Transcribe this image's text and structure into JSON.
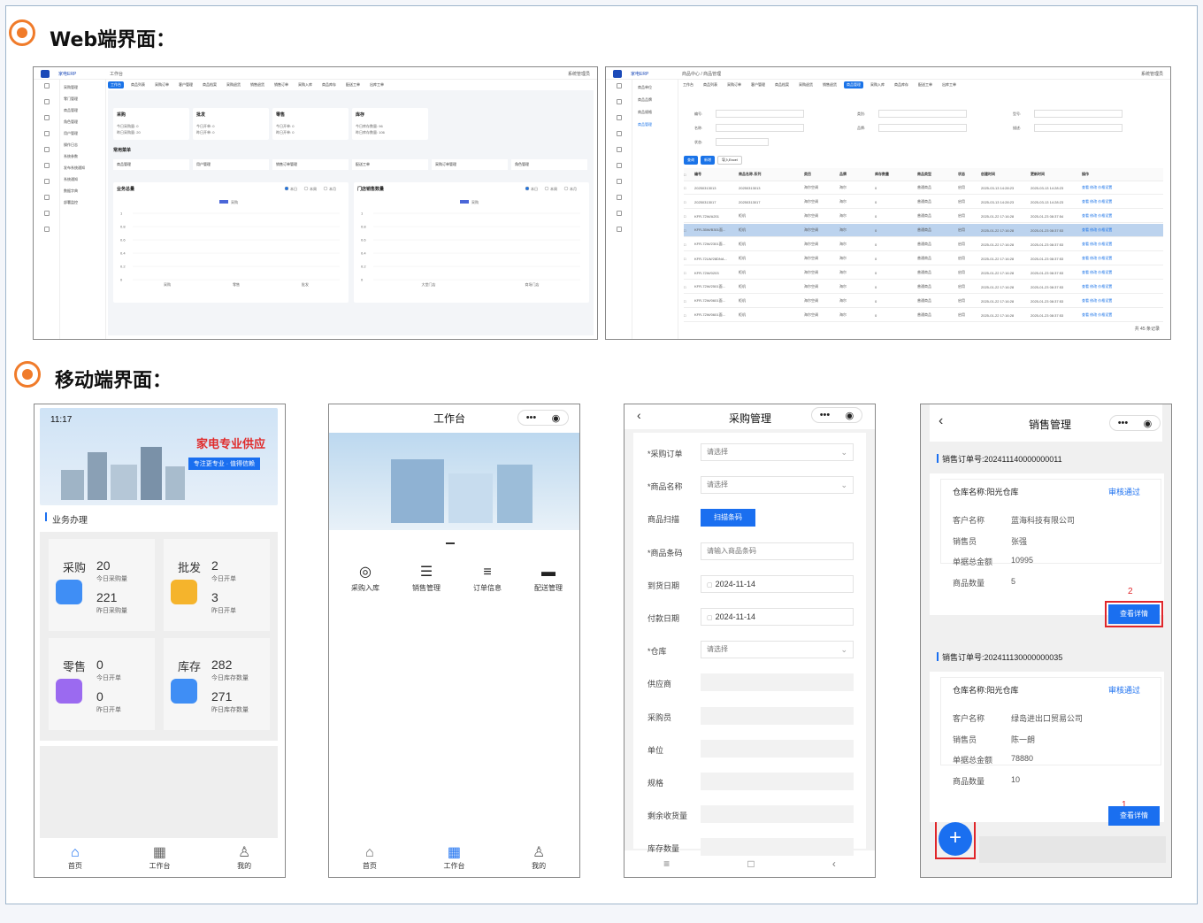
{
  "sections": {
    "web_title": "Web端界面：",
    "mobile_title": "移动端界面："
  },
  "web1": {
    "brand": "家电ERP",
    "breadcrumb": "工作台",
    "user": "系统管理员",
    "tabs": [
      "工作台",
      "商品列表",
      "采购订单",
      "客户管理",
      "商品档案",
      "采购退货",
      "销售退货",
      "销售订单",
      "采购入库",
      "商品库存",
      "配送工单",
      "出库工单"
    ],
    "menu": [
      "采购管理",
      "零门管理",
      "商品管理",
      "角色管理",
      "用户管理",
      "操作日志",
      "系统参数",
      "发布系统通知",
      "系统通知",
      "数据字典",
      "部署监控"
    ],
    "cards": [
      {
        "title": "采购",
        "l1": "今日采购量: 0",
        "l2": "昨日采购量: 20"
      },
      {
        "title": "批发",
        "l1": "今日开单: 0",
        "l2": "昨日开单: 0"
      },
      {
        "title": "零售",
        "l1": "今日开单: 0",
        "l2": "昨日开单: 0"
      },
      {
        "title": "库存",
        "l1": "今日库存数量: 96",
        "l2": "昨日库存数量: 106"
      }
    ],
    "common_title": "常用菜单",
    "common": [
      "商品管理",
      "用户管理",
      "销售订单管理",
      "配送工单",
      "采购订单管理",
      "角色管理"
    ],
    "chart1": {
      "title": "业务总量",
      "legend": "采购",
      "filters": [
        "本日",
        "本周",
        "本月"
      ],
      "ticks": [
        "1",
        "0.8",
        "0.6",
        "0.4",
        "0.2",
        "0"
      ],
      "x": [
        "采购",
        "零售",
        "批发"
      ]
    },
    "chart2": {
      "title": "门店销售数量",
      "legend": "采购",
      "filters": [
        "本日",
        "本周",
        "本月"
      ],
      "ticks": [
        "1",
        "0.8",
        "0.6",
        "0.4",
        "0.2",
        "0"
      ],
      "x": [
        "大堂门店",
        "商场门店"
      ]
    }
  },
  "web2": {
    "brand": "家电ERP",
    "breadcrumb": "商品中心 / 商品管理",
    "user": "系统管理员",
    "tabs": [
      "工作台",
      "商品列表",
      "采购订单",
      "客户管理",
      "商品档案",
      "采购退货",
      "销售退货",
      "商品管理",
      "采购入库",
      "商品库存",
      "配送工单",
      "出库工单"
    ],
    "menu": [
      "商品单位",
      "商品品牌",
      "商品规格",
      "商品管理"
    ],
    "filters": [
      "编号:",
      "类别:",
      "型号:",
      "名称:",
      "品牌:",
      "描述:",
      "状态:"
    ],
    "buttons": [
      "查询",
      "新增",
      "导入Excel"
    ],
    "headers": [
      "编号",
      "商品名称-系列",
      "类目",
      "品牌",
      "库存数量",
      "商品类型",
      "状态",
      "创建时间",
      "更新时间",
      "操作"
    ],
    "rows": [
      [
        "20250313013",
        "20250313013",
        "海尔空调",
        "海尔",
        "0",
        "普通商品",
        "启用",
        "2025-03-13 14:28:23",
        "2025-03-13 14:28:23",
        "查看 修改 价格设置"
      ],
      [
        "20250313017",
        "20250313017",
        "海尔空调",
        "海尔",
        "0",
        "普通商品",
        "启用",
        "2025-03-13 14:28:23",
        "2025-03-13 14:28:23",
        "查看 修改 价格设置"
      ],
      [
        "KFR-72W/A201",
        "柜机",
        "海尔空调",
        "海尔",
        "0",
        "普通商品",
        "启用",
        "2025-01-22 17:16:28",
        "2025-01-23 08:37:54",
        "查看 修改 价格设置"
      ],
      [
        "KFR-35W/B301面...",
        "柜机",
        "海尔空调",
        "海尔",
        "0",
        "普通商品",
        "启用",
        "2025-01-22 17:16:28",
        "2025-01-23 08:37:53",
        "查看 修改 价格设置"
      ],
      [
        "KFR-72W/2301面...",
        "柜机",
        "海尔空调",
        "海尔",
        "0",
        "普通商品",
        "启用",
        "2025-01-22 17:16:28",
        "2025-01-23 08:37:53",
        "查看 修改 价格设置"
      ],
      [
        "KFR-72LW/28DNA...",
        "柜机",
        "海尔空调",
        "海尔",
        "0",
        "普通商品",
        "启用",
        "2025-01-22 17:16:28",
        "2025-01-23 08:37:53",
        "查看 修改 价格设置"
      ],
      [
        "KFR-72W/0203",
        "柜机",
        "海尔空调",
        "海尔",
        "0",
        "普通商品",
        "启用",
        "2025-01-22 17:16:28",
        "2025-01-23 08:37:53",
        "查看 修改 价格设置"
      ],
      [
        "KFR-72W/2501面...",
        "柜机",
        "海尔空调",
        "海尔",
        "0",
        "普通商品",
        "启用",
        "2025-01-22 17:16:28",
        "2025-01-23 08:37:53",
        "查看 修改 价格设置"
      ],
      [
        "KFR-72W/0601面...",
        "柜机",
        "海尔空调",
        "海尔",
        "0",
        "普通商品",
        "启用",
        "2025-01-22 17:16:28",
        "2025-01-23 08:37:53",
        "查看 修改 价格设置"
      ],
      [
        "KFR-72W/0601面...",
        "柜机",
        "海尔空调",
        "海尔",
        "0",
        "普通商品",
        "启用",
        "2025-01-22 17:16:28",
        "2025-01-23 08:37:53",
        "查看 修改 价格设置"
      ]
    ],
    "pagination": "共 45 条记录"
  },
  "mobile1": {
    "time": "11:17",
    "banner_title": "家电专业供应",
    "banner_sub": "专注更专业 · 值得信赖",
    "section": "业务办理",
    "cards": [
      {
        "name": "采购",
        "v1": "20",
        "l1": "今日采购量",
        "v2": "221",
        "l2": "昨日采购量"
      },
      {
        "name": "批发",
        "v1": "2",
        "l1": "今日开单",
        "v2": "3",
        "l2": "昨日开单"
      },
      {
        "name": "零售",
        "v1": "0",
        "l1": "今日开单",
        "v2": "0",
        "l2": "昨日开单"
      },
      {
        "name": "库存",
        "v1": "282",
        "l1": "今日库存数量",
        "v2": "271",
        "l2": "昨日库存数量"
      }
    ],
    "nav": [
      "首页",
      "工作台",
      "我的"
    ]
  },
  "mobile2": {
    "title": "工作台",
    "items": [
      "采购入库",
      "销售管理",
      "订单信息",
      "配送管理"
    ],
    "nav": [
      "首页",
      "工作台",
      "我的"
    ]
  },
  "mobile3": {
    "title": "采购管理",
    "fields": [
      {
        "label": "*采购订单",
        "value": "请选择",
        "kind": "select"
      },
      {
        "label": "*商品名称",
        "value": "请选择",
        "kind": "select"
      },
      {
        "label": "商品扫描",
        "value": "扫描条码",
        "kind": "button"
      },
      {
        "label": "*商品条码",
        "value": "请输入商品条码",
        "kind": "input"
      },
      {
        "label": "到货日期",
        "value": "2024-11-14",
        "kind": "date"
      },
      {
        "label": "付款日期",
        "value": "2024-11-14",
        "kind": "date"
      },
      {
        "label": "*仓库",
        "value": "请选择",
        "kind": "select"
      },
      {
        "label": "供应商",
        "value": "",
        "kind": "grey"
      },
      {
        "label": "采购员",
        "value": "",
        "kind": "grey"
      },
      {
        "label": "单位",
        "value": "",
        "kind": "grey"
      },
      {
        "label": "规格",
        "value": "",
        "kind": "grey"
      },
      {
        "label": "剩余收货量",
        "value": "",
        "kind": "grey"
      },
      {
        "label": "库存数量",
        "value": "",
        "kind": "grey"
      }
    ]
  },
  "mobile4": {
    "title": "销售管理",
    "orders": [
      {
        "no": "销售订单号:202411140000000011",
        "warehouse": "仓库名称:阳光仓库",
        "status": "审核通过",
        "customer": "蓝海科技有限公司",
        "seller": "张强",
        "amount": "10995",
        "qty": "5",
        "button": "查看详情",
        "marker": "2"
      },
      {
        "no": "销售订单号:202411130000000035",
        "warehouse": "仓库名称:阳光仓库",
        "status": "审核通过",
        "customer": "绿岛进出口贸易公司",
        "seller": "陈一朗",
        "amount": "78880",
        "qty": "10",
        "button": "查看详情",
        "marker": "1"
      }
    ],
    "labels": {
      "customer": "客户名称",
      "seller": "销售员",
      "amount": "单据总金额",
      "qty": "商品数量"
    },
    "fab": "+"
  },
  "colors": {
    "accent": "#1a6ff0",
    "orange": "#f07b2a",
    "highlight": "#e0262a"
  }
}
